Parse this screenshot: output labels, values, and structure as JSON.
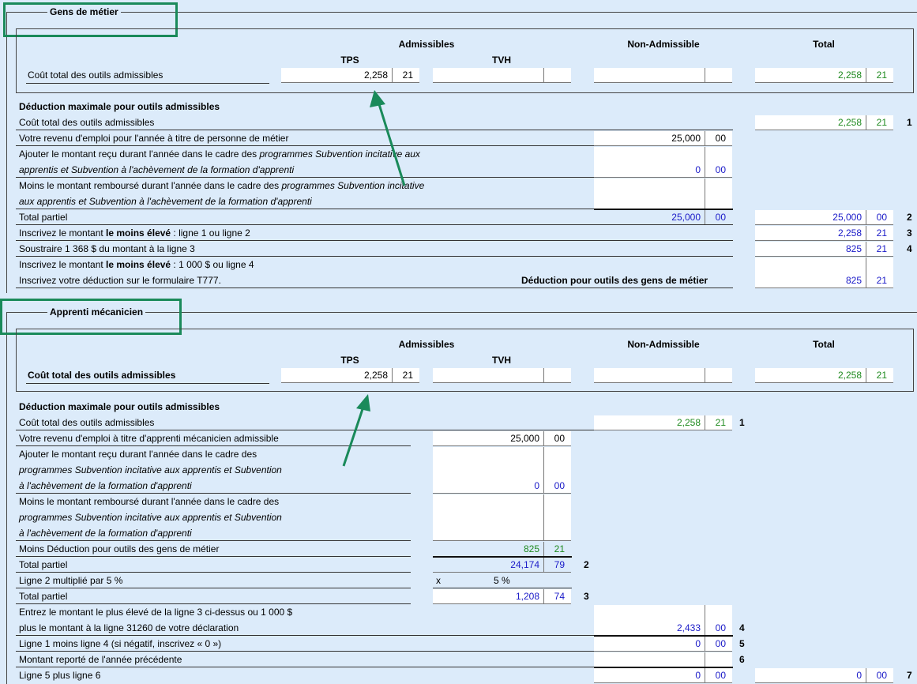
{
  "s1": {
    "legend": "Gens de métier",
    "hdr_admissibles": "Admissibles",
    "hdr_non_admissible": "Non-Admissible",
    "hdr_total": "Total",
    "hdr_tps": "TPS",
    "hdr_tvh": "TVH",
    "cout_total_label": "Coût total des outils admissibles",
    "tps_dollars": "2,258",
    "tps_cents": "21",
    "total_dollars": "2,258",
    "total_cents": "21",
    "deduction_max_title": "Déduction maximale pour outils admissibles",
    "rows": {
      "cout_total": "Coût total des outils admissibles",
      "revenu": "Votre revenu d'emploi pour l'année à titre de personne de métier",
      "ajouter_a": "Ajouter le montant reçu durant l'année dans le cadre des ",
      "ajouter_a_i": "programmes Subvention incitative aux",
      "ajouter_b_i": "apprentis et Subvention à l'achèvement de la formation d'apprenti",
      "moins_a": "Moins le montant remboursé durant l'année dans le cadre des ",
      "moins_a_i": "programmes Subvention incitative",
      "moins_b_i": "aux apprentis et Subvention à l'achèvement de la formation d'apprenti",
      "total_partiel": "Total partiel",
      "inscrivez1_a": "Inscrivez le montant ",
      "inscrivez1_b": "le moins élevé",
      "inscrivez1_c": " : ligne 1 ou ligne 2",
      "soustraire": "Soustraire 1 368 $ du montant à la ligne 3",
      "inscrivez2_a": "Inscrivez le montant ",
      "inscrivez2_b": "le moins élevé",
      "inscrivez2_c": " : 1 000 $ ou ligne 4",
      "inscrivez_ded": "Inscrivez votre déduction sur le formulaire T777.",
      "ded_label": "Déduction pour outils des gens de métier"
    },
    "vals": {
      "l1_d": "2,258",
      "l1_c": "21",
      "rev_d": "25,000",
      "rev_c": "00",
      "ajo_d": "0",
      "ajo_c": "00",
      "tp_in_d": "25,000",
      "tp_in_c": "00",
      "l2_d": "25,000",
      "l2_c": "00",
      "l3_d": "2,258",
      "l3_c": "21",
      "l4_d": "825",
      "l4_c": "21",
      "ded_d": "825",
      "ded_c": "21"
    },
    "line_nums": [
      "1",
      "2",
      "3",
      "4"
    ]
  },
  "s2": {
    "legend": "Apprenti mécanicien",
    "hdr_admissibles": "Admissibles",
    "hdr_non_admissible": "Non-Admissible",
    "hdr_total": "Total",
    "hdr_tps": "TPS",
    "hdr_tvh": "TVH",
    "cout_total_label": "Coût total des outils admissibles",
    "tps_dollars": "2,258",
    "tps_cents": "21",
    "total_dollars": "2,258",
    "total_cents": "21",
    "deduction_max_title": "Déduction maximale pour outils admissibles",
    "rows": {
      "cout_total": "Coût total des outils admissibles",
      "revenu": "Votre revenu d'emploi à titre d'apprenti mécanicien admissible",
      "ajouter_a": "Ajouter le montant reçu durant l'année dans le cadre des",
      "ajouter_b_i": "programmes Subvention incitative aux apprentis et Subvention",
      "ajouter_c_i": "à l'achèvement de la formation d'apprenti",
      "moins_a": "Moins le montant remboursé durant l'année dans le cadre des",
      "moins_b_i": "programmes Subvention incitative aux apprentis et Subvention",
      "moins_c_i": "à l'achèvement de la formation d'apprenti",
      "moins_ded": "Moins Déduction pour outils des gens de métier",
      "total_partiel": "Total partiel",
      "ligne2x5": "Ligne 2 multiplié par 5 %",
      "total_partiel2": "Total partiel",
      "entrez_a": "Entrez le montant le plus élevé de la ligne 3 ci-dessus ou 1 000 $",
      "entrez_b": "plus le montant à la ligne 31260 de votre déclaration",
      "ligne1moins4": "Ligne 1 moins ligne 4 (si négatif, inscrivez « 0 »)",
      "montant_reporte": "Montant reporté de l'année précédente",
      "ligne5plus6": "Ligne 5 plus ligne 6"
    },
    "vals": {
      "l1_d": "2,258",
      "l1_c": "21",
      "rev_d": "25,000",
      "rev_c": "00",
      "ajo_d": "0",
      "ajo_c": "00",
      "mded_d": "825",
      "mded_c": "21",
      "tp_d": "24,174",
      "tp_c": "79",
      "x_sym": "x",
      "pct": "5 %",
      "tp2_d": "1,208",
      "tp2_c": "74",
      "l4_d": "2,433",
      "l4_c": "00",
      "l5_d": "0",
      "l5_c": "00",
      "l7a_d": "0",
      "l7a_c": "00",
      "l7b_d": "0",
      "l7b_c": "00"
    },
    "line_nums": [
      "1",
      "2",
      "3",
      "4",
      "5",
      "6",
      "7"
    ]
  },
  "colors": {
    "background": "#dcebfa",
    "highlight": "#1a8a5a",
    "green_value": "#1f8a1f",
    "blue_value": "#1a1ac8"
  }
}
